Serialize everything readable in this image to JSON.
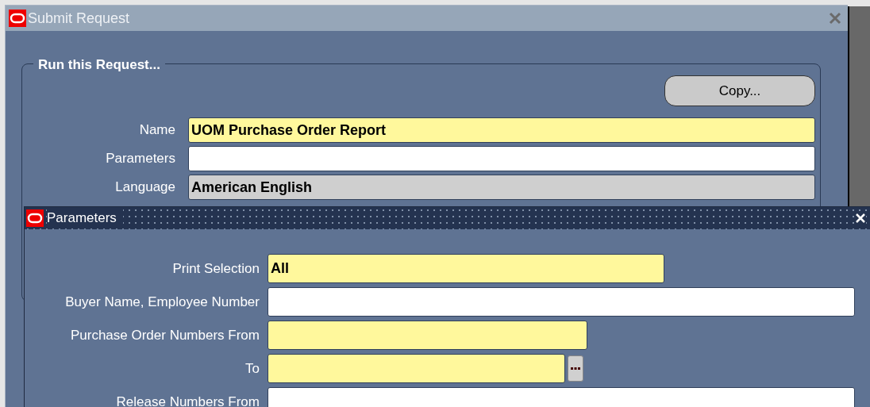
{
  "window": {
    "title": "Submit Request"
  },
  "request_group": {
    "title": "Run this Request...",
    "copy_button": "Copy...",
    "fields": [
      {
        "label": "Name",
        "value": "UOM Purchase Order Report",
        "kind": "required"
      },
      {
        "label": "Parameters",
        "kind": "optional"
      },
      {
        "label": "Language",
        "value": "American English",
        "kind": "readonly"
      }
    ]
  },
  "parameters_window": {
    "title": "Parameters",
    "fields": [
      {
        "label": "Print Selection",
        "value": "All",
        "kind": "required",
        "list_button": false
      },
      {
        "label": "Buyer Name, Employee Number",
        "kind": "optional",
        "list_button": false
      },
      {
        "label": "Purchase Order Numbers From",
        "kind": "required",
        "list_button": false
      },
      {
        "label": "To",
        "kind": "required",
        "list_button": true
      },
      {
        "label": "Release Numbers From",
        "kind": "optional",
        "list_button": false
      }
    ]
  }
}
